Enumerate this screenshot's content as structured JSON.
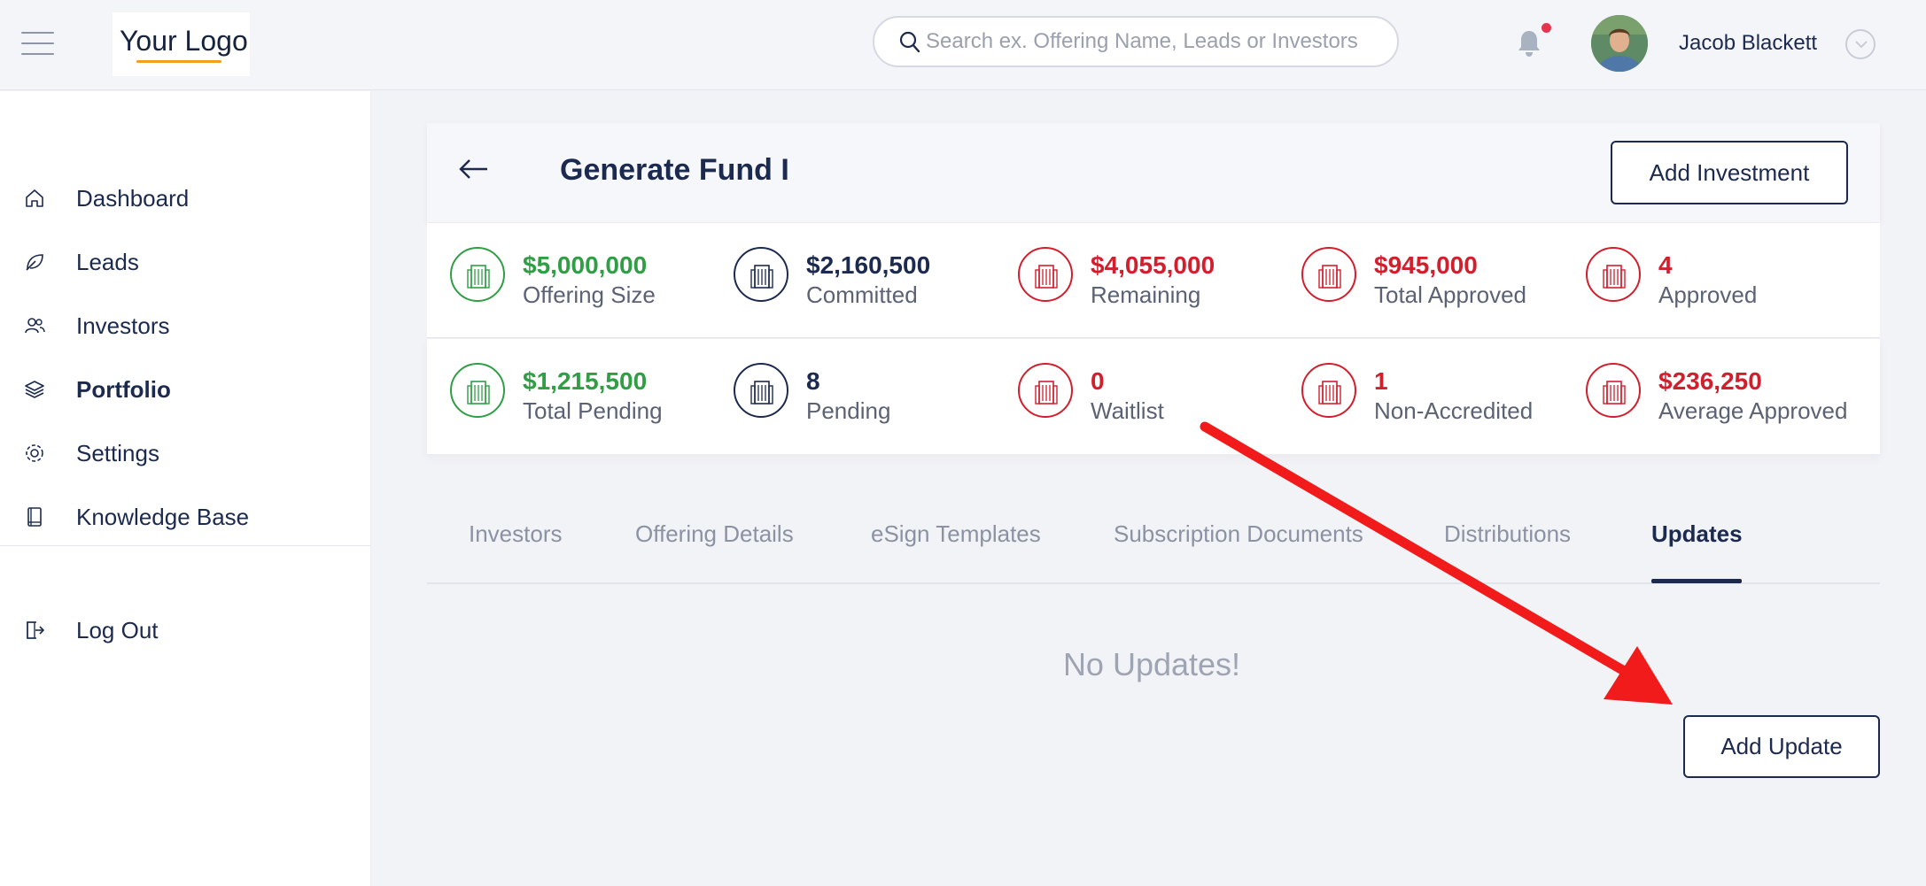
{
  "header": {
    "logo_text": "Your Logo",
    "search_placeholder": "Search ex. Offering Name, Leads or Investors",
    "user_name": "Jacob Blackett"
  },
  "sidebar": {
    "items": [
      {
        "label": "Dashboard",
        "icon": "home-icon"
      },
      {
        "label": "Leads",
        "icon": "leaf-icon"
      },
      {
        "label": "Investors",
        "icon": "users-icon"
      },
      {
        "label": "Portfolio",
        "icon": "layers-icon",
        "active": true
      },
      {
        "label": "Settings",
        "icon": "gear-icon"
      },
      {
        "label": "Knowledge Base",
        "icon": "book-icon"
      }
    ],
    "logout_label": "Log Out"
  },
  "fund": {
    "title": "Generate Fund I",
    "add_investment_label": "Add Investment"
  },
  "stats": {
    "row1": [
      {
        "value": "$5,000,000",
        "label": "Offering Size",
        "color": "green"
      },
      {
        "value": "$2,160,500",
        "label": "Committed",
        "color": "navy"
      },
      {
        "value": "$4,055,000",
        "label": "Remaining",
        "color": "red"
      },
      {
        "value": "$945,000",
        "label": "Total Approved",
        "color": "red"
      },
      {
        "value": "4",
        "label": "Approved",
        "color": "red"
      }
    ],
    "row2": [
      {
        "value": "$1,215,500",
        "label": "Total Pending",
        "color": "green"
      },
      {
        "value": "8",
        "label": "Pending",
        "color": "navy"
      },
      {
        "value": "0",
        "label": "Waitlist",
        "color": "red"
      },
      {
        "value": "1",
        "label": "Non-Accredited",
        "color": "red"
      },
      {
        "value": "$236,250",
        "label": "Average Approved",
        "color": "red"
      }
    ]
  },
  "tabs": [
    {
      "label": "Investors"
    },
    {
      "label": "Offering Details"
    },
    {
      "label": "eSign Templates"
    },
    {
      "label": "Subscription Documents"
    },
    {
      "label": "Distributions"
    },
    {
      "label": "Updates",
      "active": true
    }
  ],
  "updates": {
    "empty_message": "No Updates!",
    "add_update_label": "Add Update"
  },
  "colors": {
    "primary": "#1b2a4e",
    "green": "#2f9e44",
    "red": "#d11f2e",
    "annotation_arrow": "#f21b1b",
    "logo_accent": "#f0a01c"
  }
}
